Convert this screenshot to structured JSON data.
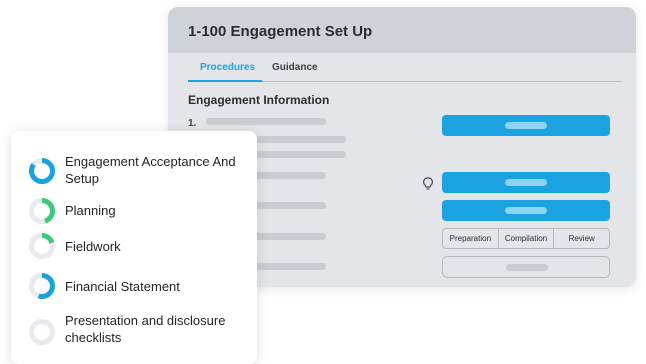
{
  "window": {
    "title": "1-100 Engagement Set Up",
    "tabs": [
      {
        "label": "Procedures",
        "active": true
      },
      {
        "label": "Guidance",
        "active": false
      }
    ],
    "section_title": "Engagement Information",
    "item_number": "1.",
    "review_steps": [
      "Preparation",
      "Compilation",
      "Review"
    ]
  },
  "phases": [
    {
      "label": "Engagement Acceptance And Setup",
      "progress": 0.85,
      "color": "#1aa3e0"
    },
    {
      "label": "Planning",
      "progress": 0.45,
      "color": "#3ec97a"
    },
    {
      "label": "Fieldwork",
      "progress": 0.2,
      "color": "#3ec97a"
    },
    {
      "label": "Financial Statement",
      "progress": 0.55,
      "color": "#1aa3e0"
    },
    {
      "label": "Presentation and disclosure checklists",
      "progress": 0.0,
      "color": "#1aa3e0"
    }
  ],
  "colors": {
    "accent": "#1aa3e0",
    "success": "#3ec97a",
    "track": "#e8eaed"
  },
  "icons": [
    "lightbulb-icon",
    "progress-ring-icon"
  ]
}
